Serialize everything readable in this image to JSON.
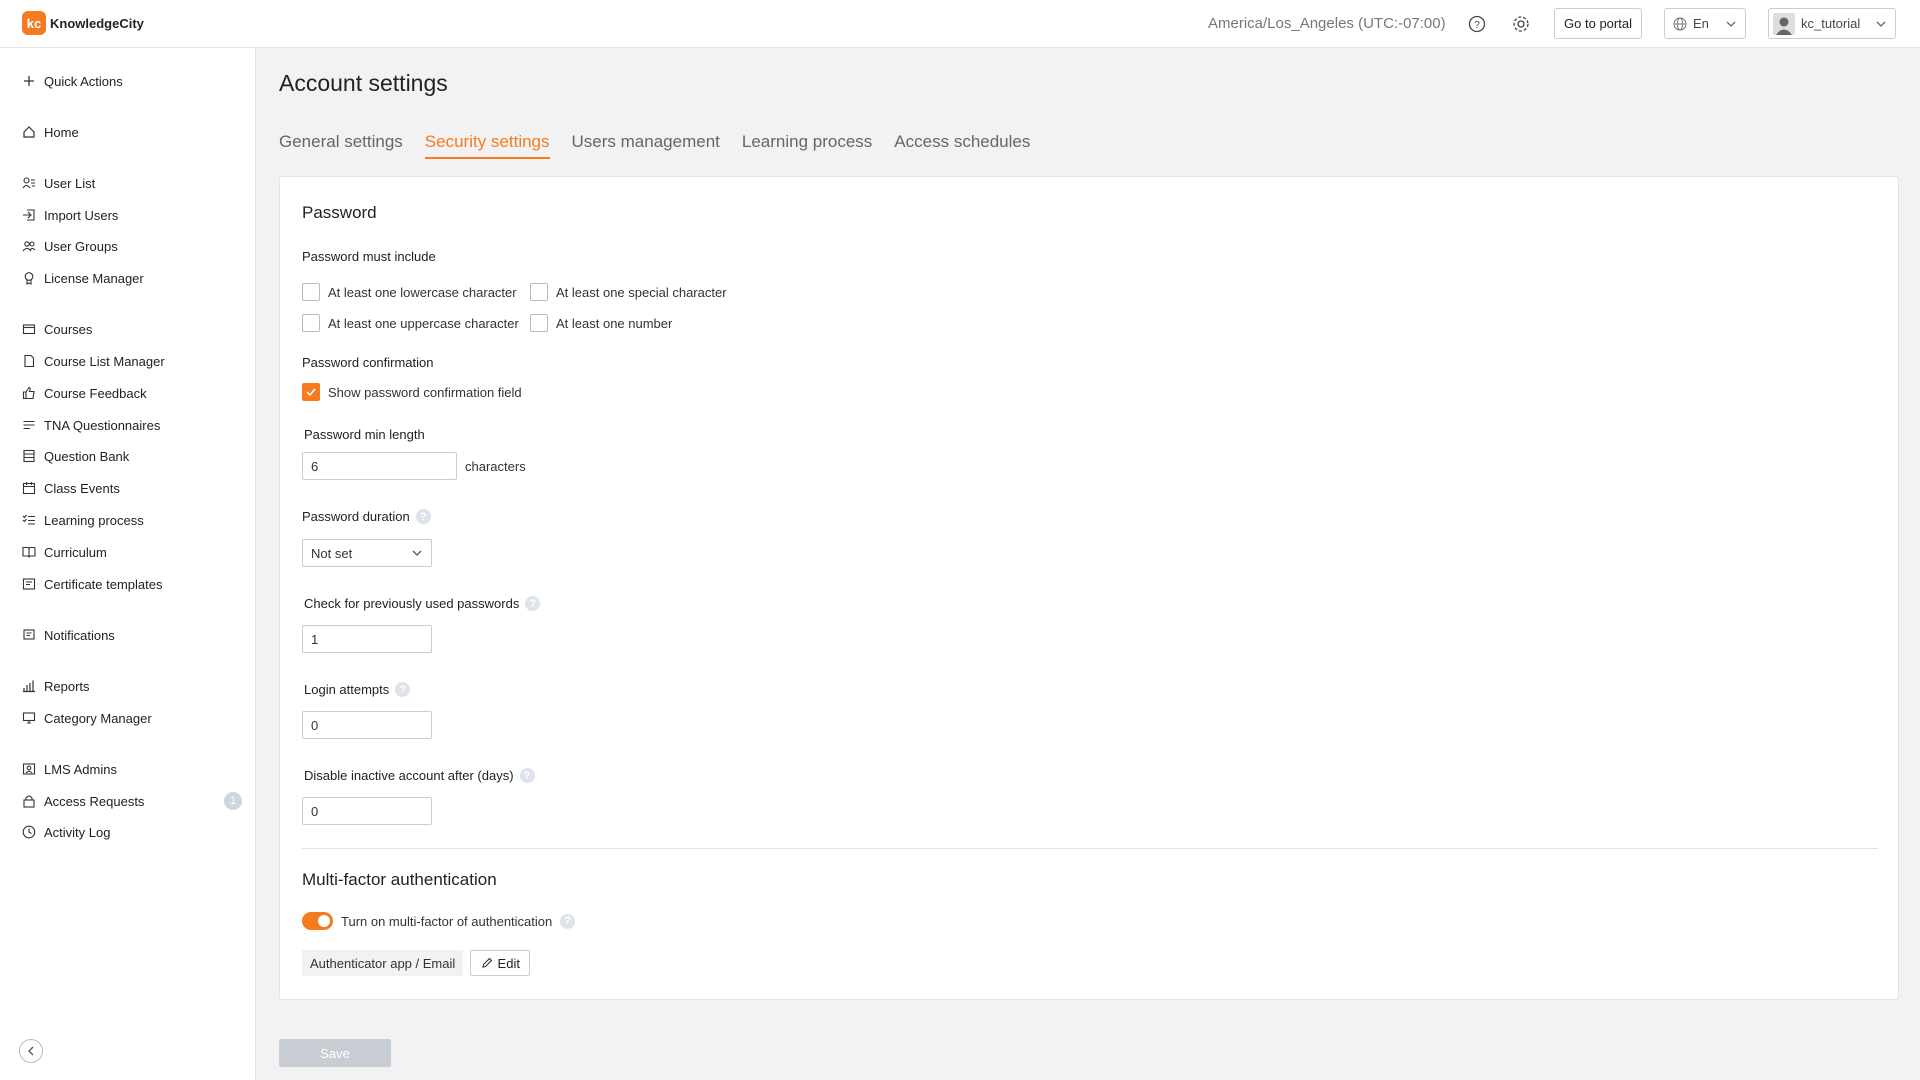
{
  "brand": {
    "name": "KnowledgeCity",
    "mark": "kc",
    "accent": "#f47b20"
  },
  "topbar": {
    "timezone": "America/Los_Angeles (UTC:-07:00)",
    "portal_label": "Go to portal",
    "language": "En",
    "username": "kc_tutorial"
  },
  "sidebar": {
    "quick_actions": "Quick Actions",
    "home": "Home",
    "user_list": "User List",
    "import_users": "Import Users",
    "user_groups": "User Groups",
    "license_manager": "License Manager",
    "courses": "Courses",
    "course_list_manager": "Course List Manager",
    "course_feedback": "Course Feedback",
    "tna_questionnaires": "TNA Questionnaires",
    "question_bank": "Question Bank",
    "class_events": "Class Events",
    "learning_process": "Learning process",
    "curriculum": "Curriculum",
    "certificate_templates": "Certificate templates",
    "notifications": "Notifications",
    "reports": "Reports",
    "category_manager": "Category Manager",
    "lms_admins": "LMS Admins",
    "access_requests": "Access Requests",
    "access_requests_badge": "1",
    "activity_log": "Activity Log"
  },
  "page": {
    "title": "Account settings",
    "tabs": [
      "General settings",
      "Security settings",
      "Users management",
      "Learning process",
      "Access schedules"
    ],
    "active_tab": "Security settings"
  },
  "password": {
    "heading": "Password",
    "must_include_label": "Password must include",
    "options": {
      "lowercase": "At least one lowercase character",
      "special": "At least one special character",
      "uppercase": "At least one uppercase character",
      "number": "At least one number"
    },
    "confirmation_label": "Password confirmation",
    "confirmation_option": "Show password confirmation field",
    "min_length_label": "Password min length",
    "min_length_value": "6",
    "min_length_unit": "characters",
    "duration_label": "Password duration",
    "duration_value": "Not set",
    "previous_label": "Check for previously used passwords",
    "previous_value": "1",
    "login_attempts_label": "Login attempts",
    "login_attempts_value": "0",
    "inactive_label": "Disable inactive account after (days)",
    "inactive_value": "0"
  },
  "mfa": {
    "heading": "Multi-factor authentication",
    "toggle_label": "Turn on multi-factor of authentication",
    "method": "Authenticator app / Email",
    "edit_label": "Edit"
  },
  "actions": {
    "save_label": "Save"
  }
}
